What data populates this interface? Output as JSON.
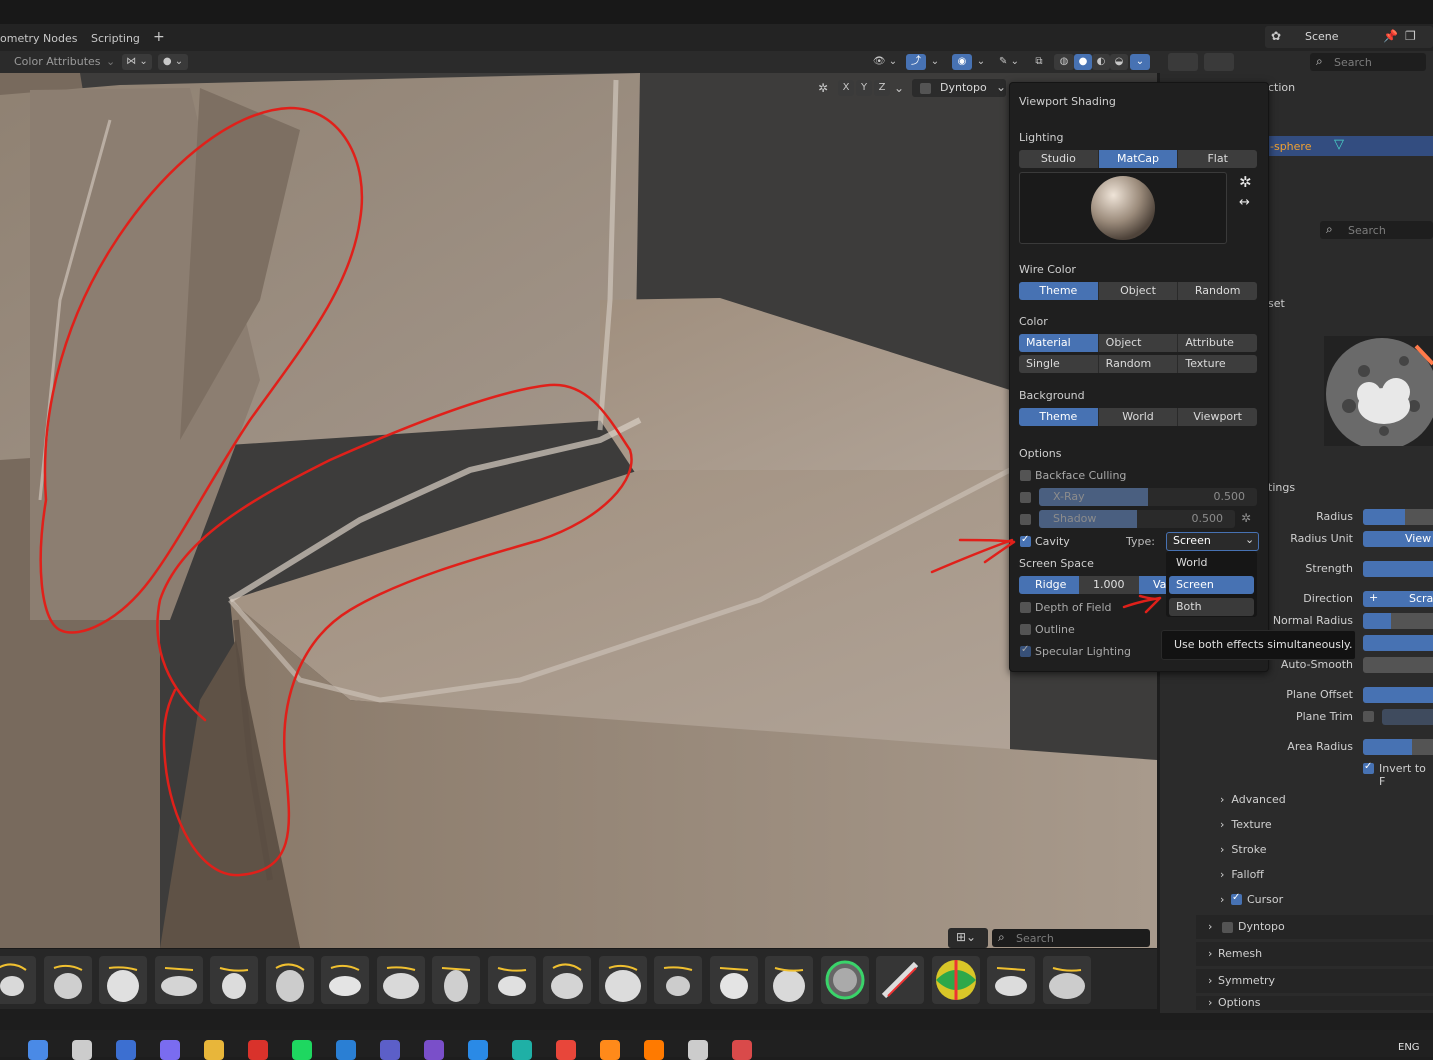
{
  "workspace_tabs": [
    "ometry Nodes",
    "Scripting"
  ],
  "add_tab_glyph": "+",
  "scene": {
    "label": "Scene",
    "search_placeholder": "Search"
  },
  "header": {
    "color_attributes": "Color Attributes",
    "mirror_axes": [
      "X",
      "Y",
      "Z"
    ],
    "dyntopo_label": "Dyntopo"
  },
  "outliner": {
    "partial_title": "ction",
    "selected_item": "-sphere",
    "search_placeholder": "Search"
  },
  "properties": {
    "partial_label_set": "set",
    "partial_settings": "tings"
  },
  "shading_popup": {
    "title": "Viewport Shading",
    "lighting": {
      "label": "Lighting",
      "options": [
        "Studio",
        "MatCap",
        "Flat"
      ],
      "selected": "MatCap"
    },
    "wire_color": {
      "label": "Wire Color",
      "options": [
        "Theme",
        "Object",
        "Random"
      ],
      "selected": "Theme"
    },
    "color": {
      "label": "Color",
      "row1": [
        "Material",
        "Object",
        "Attribute"
      ],
      "row2": [
        "Single",
        "Random",
        "Texture"
      ],
      "selected": "Material"
    },
    "background": {
      "label": "Background",
      "options": [
        "Theme",
        "World",
        "Viewport"
      ],
      "selected": "Theme"
    },
    "options": {
      "label": "Options",
      "backface_culling": {
        "label": "Backface Culling",
        "checked": false
      },
      "xray": {
        "label": "X-Ray",
        "value": "0.500",
        "fraction": 0.5,
        "checked": false
      },
      "shadow": {
        "label": "Shadow",
        "value": "0.500",
        "fraction": 0.5,
        "checked": false
      },
      "cavity": {
        "label": "Cavity",
        "checked": true,
        "type_label": "Type:",
        "type_value": "Screen"
      },
      "screen_space": {
        "label": "Screen Space"
      },
      "ridge": {
        "label": "Ridge",
        "value": "1.000",
        "valley_partial": "Va"
      },
      "depth_of_field": {
        "label": "Depth of Field",
        "checked": false
      },
      "outline": {
        "label": "Outline",
        "checked": false
      },
      "specular_lighting": {
        "label": "Specular Lighting",
        "checked": true
      }
    },
    "type_dropdown": {
      "items": [
        "World",
        "Screen",
        "Both"
      ],
      "highlighted": "Screen",
      "hovered": "Both"
    },
    "tooltip": "Use both effects simultaneously."
  },
  "brush_settings": {
    "fields": [
      {
        "label": "Radius",
        "fill": 0.6
      },
      {
        "label": "Radius Unit",
        "value": "View"
      },
      {
        "label": "Strength",
        "fill": 1.0
      },
      {
        "label": "Direction",
        "value": "Scra",
        "prefix": "+"
      },
      {
        "label": "Normal Radius",
        "fill": 0.4
      },
      {
        "label": "",
        "fill": 1.0
      },
      {
        "label": "Auto-Smooth",
        "fill": 0.0
      },
      {
        "label": "Plane Offset",
        "fill": 1.0
      },
      {
        "label": "Plane Trim",
        "fill": 0.0
      },
      {
        "label": "Area Radius",
        "fill": 0.7
      }
    ],
    "invert_label": "Invert to F",
    "subpanels": [
      "Advanced",
      "Texture",
      "Stroke",
      "Falloff",
      "Cursor"
    ],
    "sections": [
      "Dyntopo",
      "Remesh",
      "Symmetry",
      "Options"
    ]
  },
  "shelf": {
    "search_placeholder": "Search"
  },
  "taskbar": {
    "language": "ENG"
  }
}
